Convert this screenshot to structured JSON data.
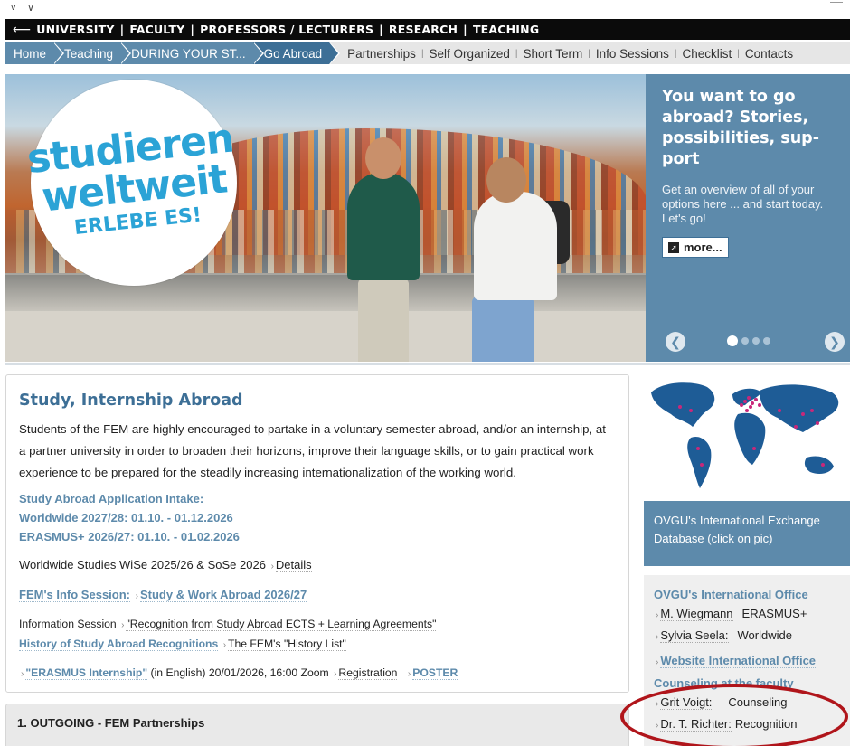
{
  "top": {
    "chevron_left": "v",
    "chevron_right": "∨"
  },
  "faculty_nav": {
    "back_arrow": "⟵",
    "items": [
      "UNIVERSITY",
      "FACULTY",
      "PROFESSORS / LECTURERS",
      "RESEARCH",
      "TEACHING"
    ],
    "separator": "|"
  },
  "breadcrumb": [
    "Home",
    "Teaching",
    "DURING YOUR ST...",
    "Go Abroad"
  ],
  "subnav": [
    "Partnerships",
    "Self Organized",
    "Short Term",
    "Info Sessions",
    "Checklist",
    "Contacts"
  ],
  "hero": {
    "badge_line1": "studieren",
    "badge_line2": "weltweit",
    "badge_line3": "ERLEBE ES!",
    "panel_title": "You want to go abroad? Stories, possibilities, sup-port",
    "panel_text": "Get an overview of all of your options here ... and start today. Let's go!",
    "more_label": "more...",
    "prev_icon": "❮",
    "next_icon": "❯",
    "active_slide": 1,
    "slide_count": 4
  },
  "main": {
    "title": "Study, Internship Abroad",
    "intro": "Students of the FEM are highly encouraged to partake in a voluntary semester abroad, and/or an internship, at a partner university in order to broaden their horizons, improve their language skills, or to gain practical work experience to be prepared for the steadily increasing internationalization of the working world.",
    "intake_heading": "Study Abroad Application Intake:",
    "intake_worldwide": "Worldwide 2027/28:  01.10. - 01.12.2026",
    "intake_erasmus": "ERASMUS+ 2026/27: 01.10. - 01.02.2026",
    "worldwide_studies": "Worldwide Studies WiSe 2025/26 & SoSe 2026",
    "details_link": "Details",
    "info_session_label": "FEM's Info Session:",
    "info_session_link": "Study & Work Abroad 2026/27",
    "information_session_text": "Information Session",
    "recognition_link": "\"Recognition from Study Abroad ECTS + Learning Agreements\"",
    "history_label": "History of Study Abroad Recognitions",
    "history_link": "The FEM's \"History List\"",
    "erasmus_internship_link": "\"ERASMUS Internship\"",
    "erasmus_internship_text": "(in English) 20/01/2026, 16:00 Zoom",
    "registration_link": "Registration",
    "poster_link": "POSTER"
  },
  "outgoing": {
    "label": "1. OUTGOING - FEM Partnerships"
  },
  "map_card": {
    "caption": "OVGU's International Exchange Database (click on pic)"
  },
  "contacts": {
    "office_heading": "OVGU's  International Office",
    "people": [
      {
        "name": "M. Wiegmann",
        "role": "ERASMUS+"
      },
      {
        "name": "Sylvia Seela:",
        "role": "Worldwide"
      }
    ],
    "website_link": "Website International Office",
    "faculty_heading": "Counseling at the faculty",
    "faculty_people": [
      {
        "name": "Grit Voigt:",
        "role": "Counseling"
      },
      {
        "name": "Dr. T. Richter:",
        "role": "Recognition"
      }
    ]
  },
  "colors": {
    "accent": "#5d8aab",
    "accent_dark": "#3d6f96",
    "highlight_ring": "#b0151b",
    "badge_blue": "#2ba3d6"
  }
}
